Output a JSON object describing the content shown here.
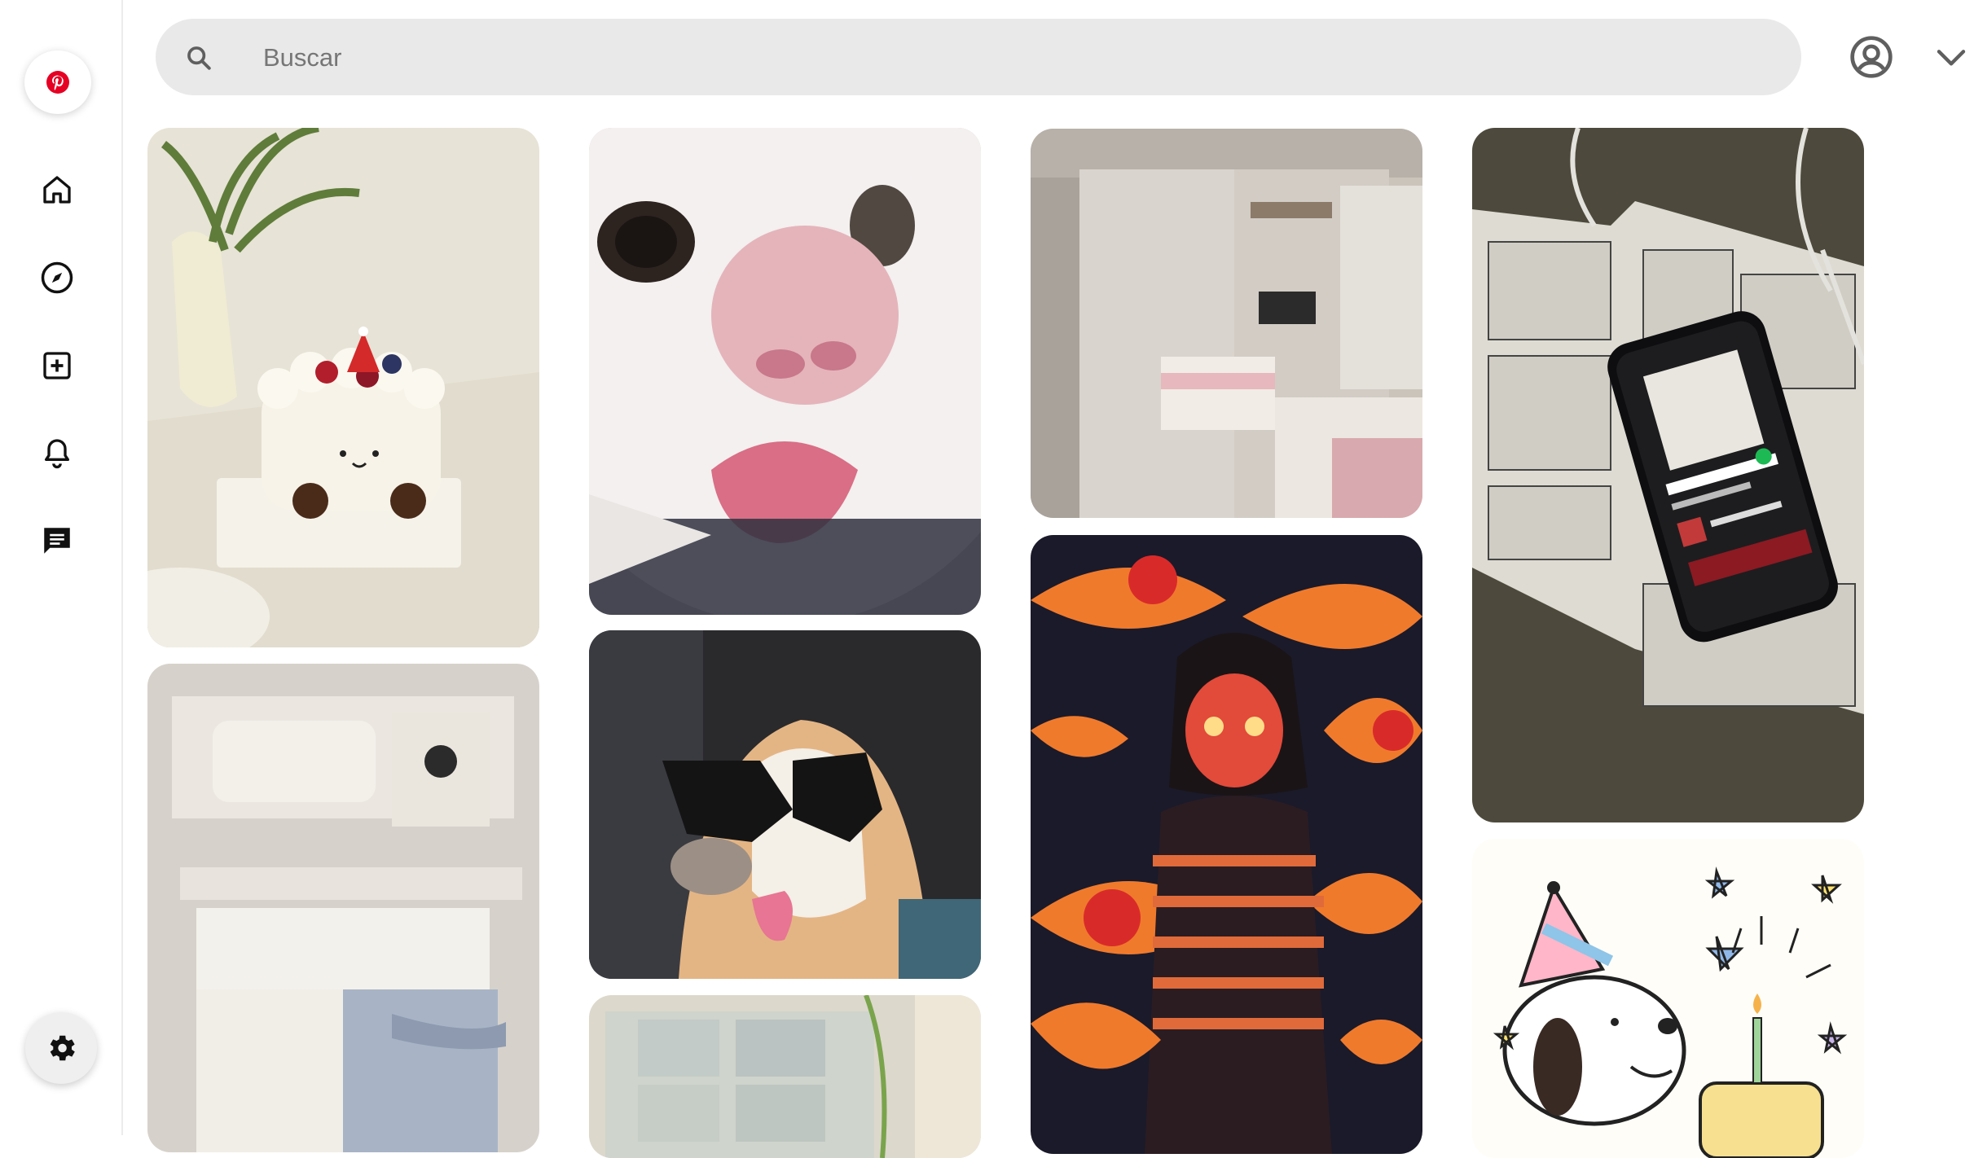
{
  "search": {
    "placeholder": "Buscar"
  },
  "sidebar": {
    "items": [
      {
        "name": "home-icon"
      },
      {
        "name": "explore-icon"
      },
      {
        "name": "create-icon"
      },
      {
        "name": "notifications-icon"
      },
      {
        "name": "messages-icon"
      }
    ],
    "settings_icon": "gear-icon",
    "logo_icon": "pinterest-logo-icon"
  },
  "header": {
    "account_icon": "account-icon",
    "menu_icon": "chevron-down-icon"
  },
  "colors": {
    "brand": "#e60023",
    "search_bg": "#e9e9e9",
    "icon": "#111111"
  },
  "pins": [
    {
      "subject": "cake"
    },
    {
      "subject": "bedroom-room-aerial"
    },
    {
      "subject": "cat-closeup"
    },
    {
      "subject": "dog-sunglasses"
    },
    {
      "subject": "calendar-wall"
    },
    {
      "subject": "bedroom-mirror-wardrobe"
    },
    {
      "subject": "anime-girl-eyes-art"
    },
    {
      "subject": "manga-phone"
    },
    {
      "subject": "snoopy-birthday"
    }
  ]
}
